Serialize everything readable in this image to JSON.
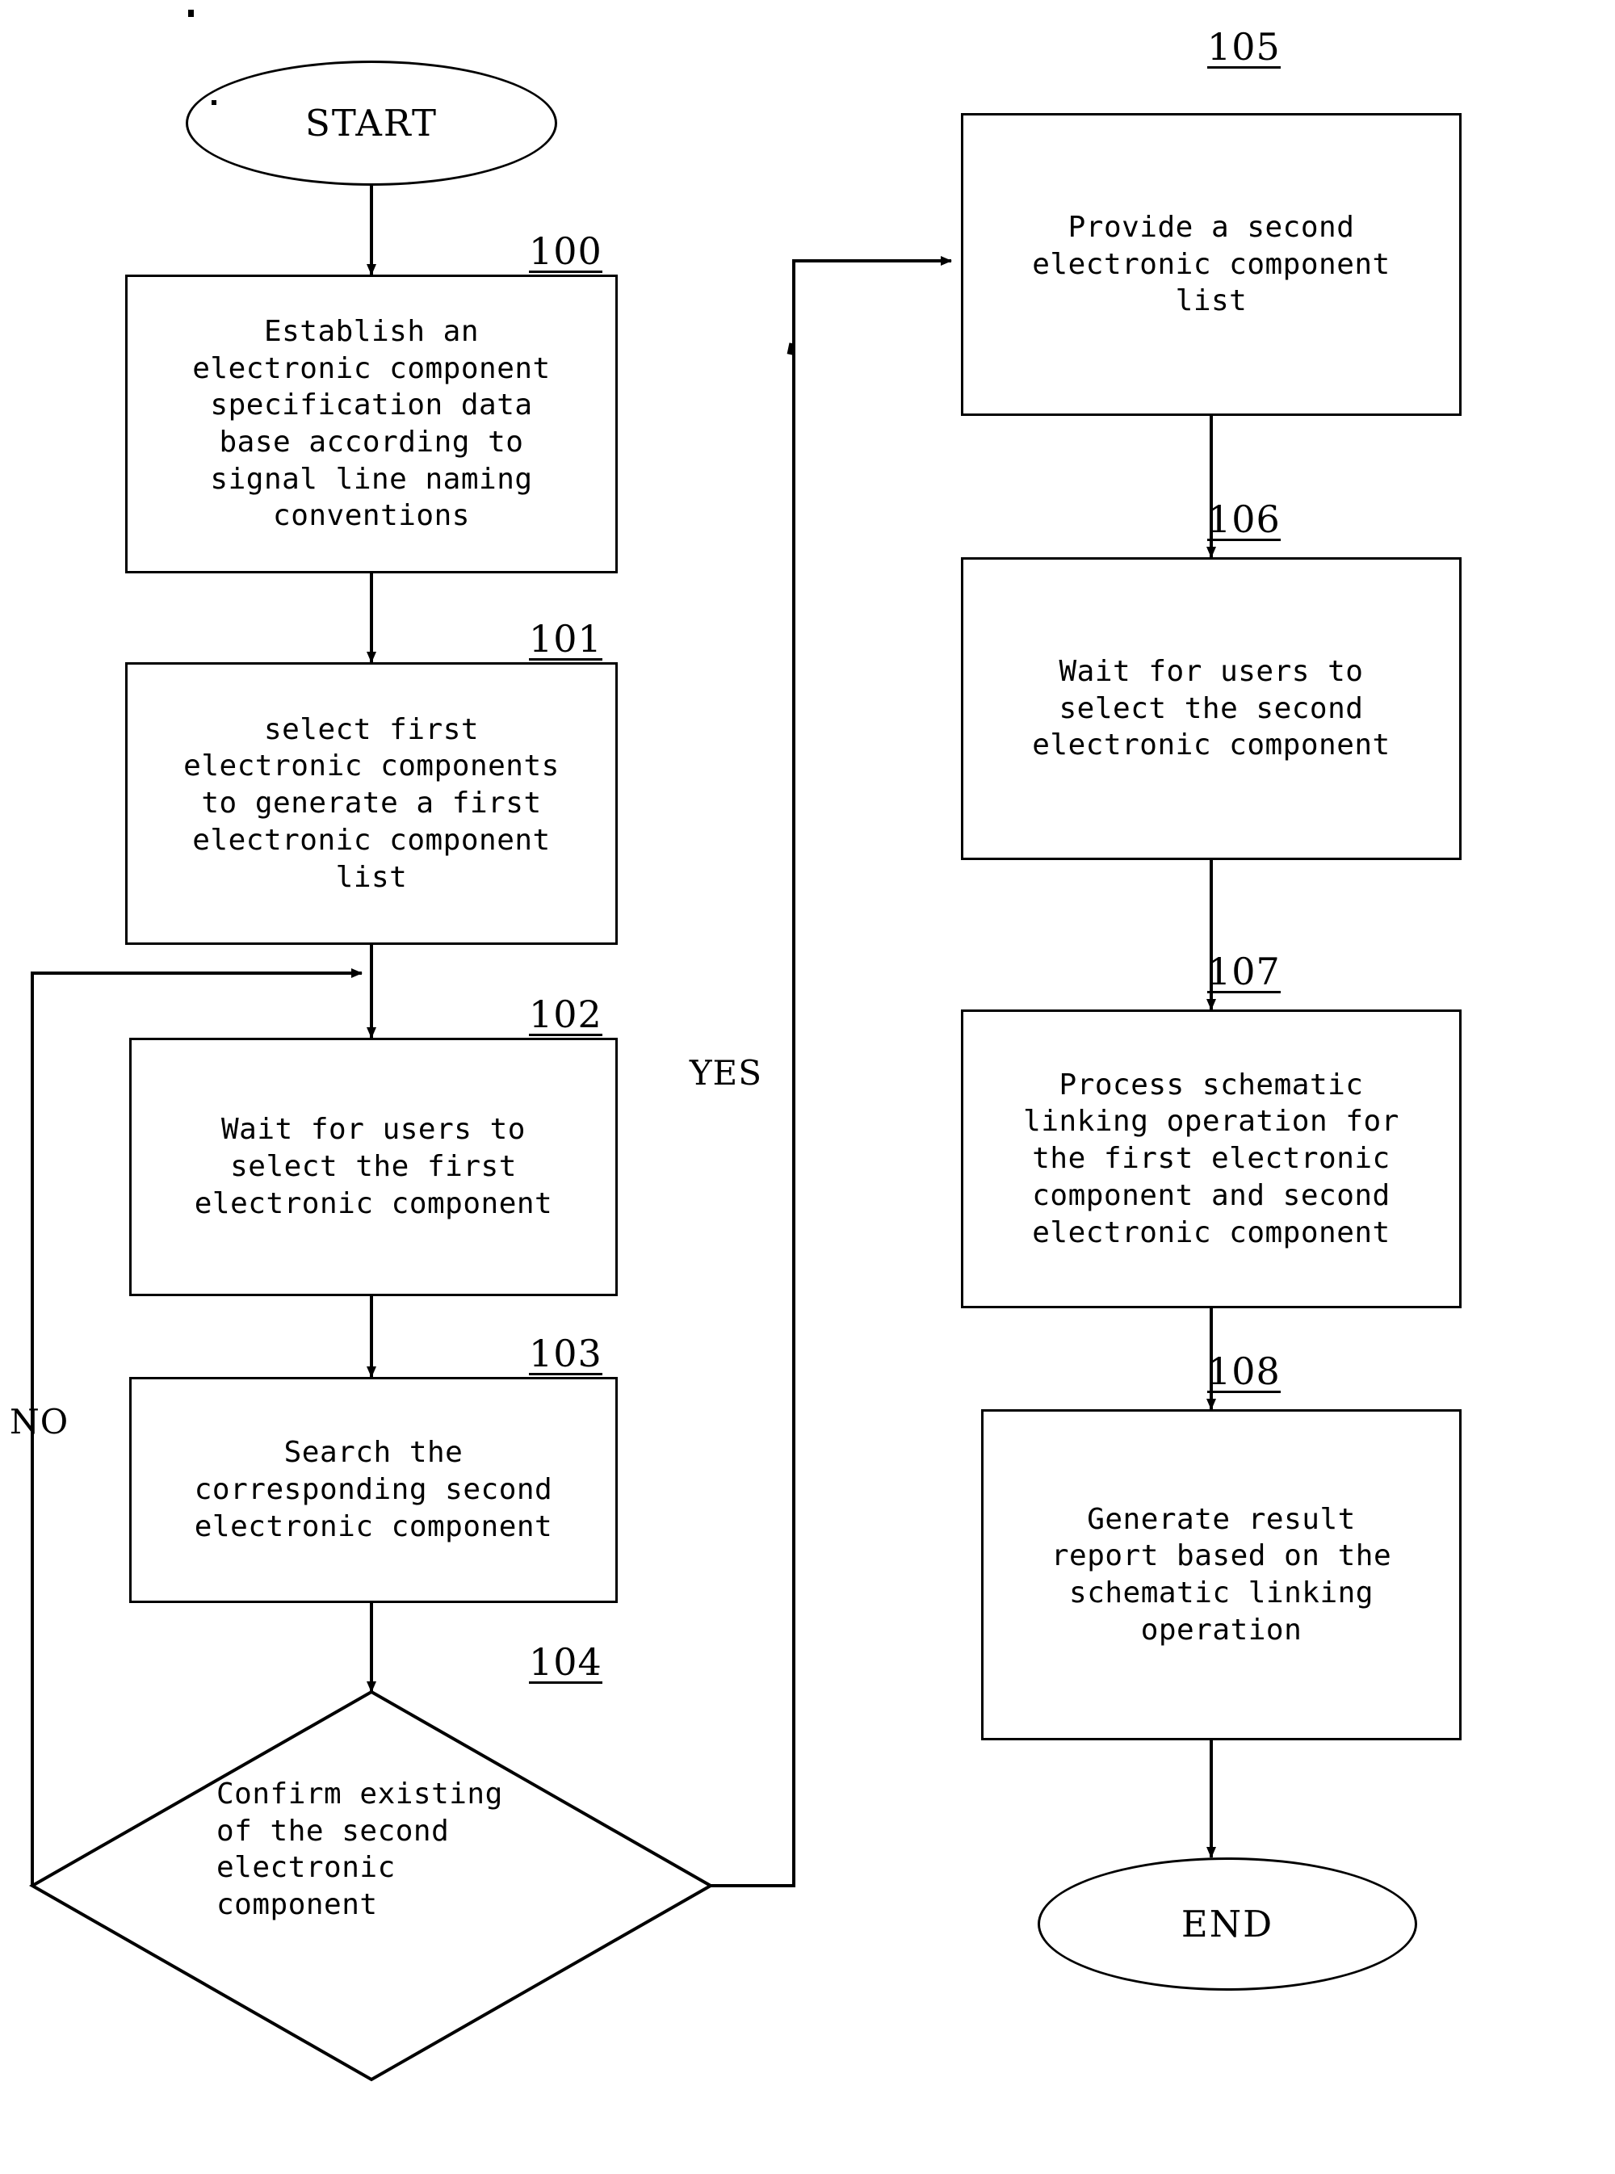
{
  "diagram": {
    "title": "Electronic component schematic linking flowchart",
    "stroke_color": "#000000",
    "background_color": "#ffffff",
    "terminals": {
      "start": "START",
      "end": "END"
    },
    "edge_labels": {
      "yes": "YES",
      "no": "NO"
    },
    "steps": [
      {
        "ref": "100",
        "text": "Establish an\nelectronic component\nspecification data\nbase according to\nsignal line naming\nconventions"
      },
      {
        "ref": "101",
        "text": "select first\nelectronic components\nto generate a first\nelectronic component\nlist"
      },
      {
        "ref": "102",
        "text": "Wait for users to\nselect the first\nelectronic component"
      },
      {
        "ref": "103",
        "text": "Search the\ncorresponding second\nelectronic component"
      },
      {
        "ref": "104",
        "text": "Confirm existing\nof the second\nelectronic\ncomponent"
      },
      {
        "ref": "105",
        "text": "Provide a second\nelectronic component\nlist"
      },
      {
        "ref": "106",
        "text": "Wait for users to\nselect the second\nelectronic component"
      },
      {
        "ref": "107",
        "text": "Process schematic\nlinking operation for\nthe first electronic\ncomponent and second\nelectronic component"
      },
      {
        "ref": "108",
        "text": "Generate result\nreport based on the\nschematic linking\noperation"
      }
    ]
  }
}
